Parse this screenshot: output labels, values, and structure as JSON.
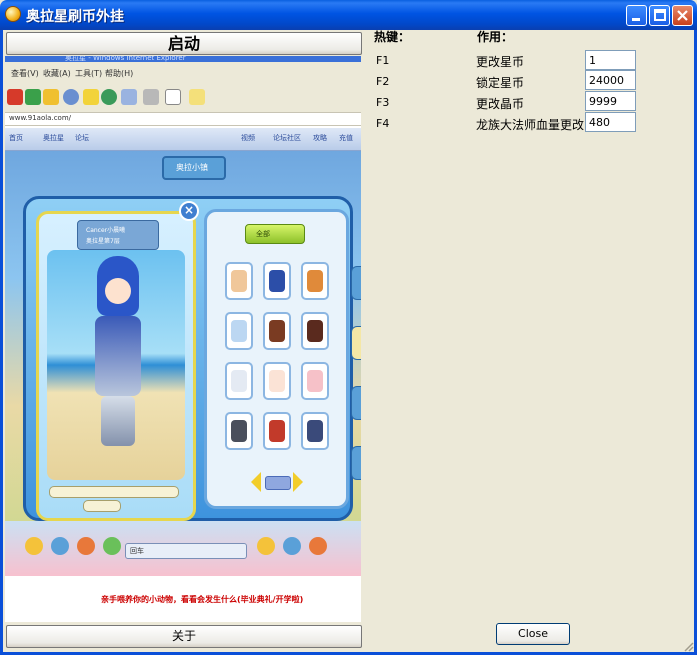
{
  "window": {
    "title": "奥拉星刷币外挂"
  },
  "left": {
    "start_label": "启动",
    "about_label": "关于",
    "browser": {
      "menu": [
        "查看(V)",
        "收藏(A)",
        "工具(T)",
        "帮助(H)"
      ],
      "address": "www.91aola.com/",
      "tabs": [
        "首页",
        "奥拉星",
        "论坛",
        "视频",
        "论坛社区",
        "攻略",
        "充值"
      ],
      "game_sign": "奥拉小镇",
      "character_name": "Cancer小晨曦",
      "character_title": "奥拉星第7层",
      "wardrobe_filter": "全部",
      "bottom_search": "回车",
      "notice": "亲手喂养你的小动物，看看会发生什么(毕业典礼/开学啦)"
    }
  },
  "right": {
    "header_key": "热键：",
    "header_action": "作用：",
    "hotkeys": [
      {
        "key": "F1",
        "action": "更改星币",
        "value": "1"
      },
      {
        "key": "F2",
        "action": "锁定星币",
        "value": "24000"
      },
      {
        "key": "F3",
        "action": "更改晶币",
        "value": "9999"
      },
      {
        "key": "F4",
        "action": "龙族大法师血量更改",
        "value": "480"
      }
    ],
    "close_label": "Close"
  }
}
